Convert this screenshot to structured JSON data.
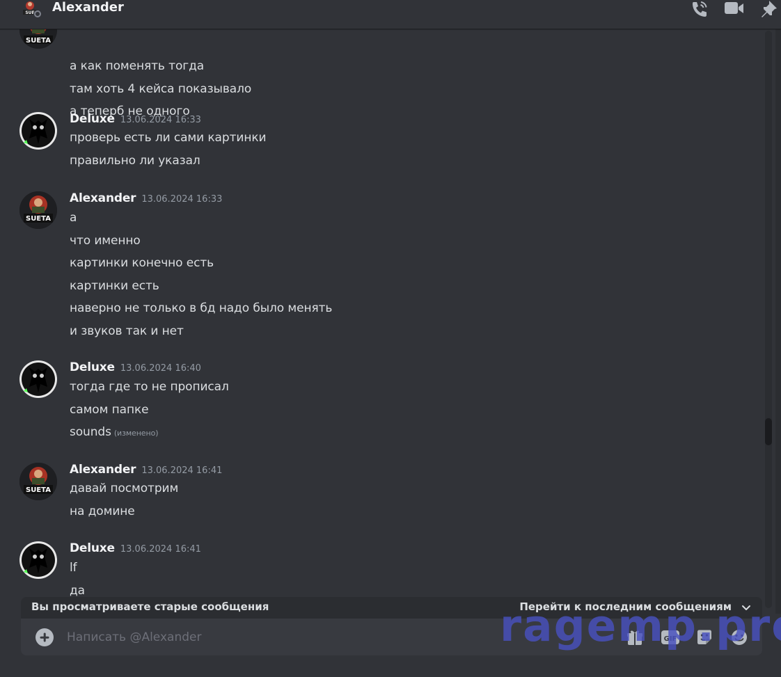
{
  "header": {
    "title": "Alexander",
    "avatar_label": "SUE",
    "icons": [
      "phone-call-icon",
      "video-camera-icon",
      "pin-icon"
    ]
  },
  "colors": {
    "background": "#313338",
    "header_title": "#f2f3f5",
    "timestamp": "#949ba4",
    "composer_bg": "#383a40",
    "watermark": "#4850be"
  },
  "continuation": {
    "lines": [
      "а как поменять тогда",
      "там хоть 4 кейса показывало",
      "а теперб не одного"
    ]
  },
  "messages": [
    {
      "author": "Deluxe",
      "time": "13.06.2024 16:33",
      "lines": [
        "проверь есть ли сами картинки",
        "правильно ли указал"
      ]
    },
    {
      "author": "Alexander",
      "time": "13.06.2024 16:33",
      "avatar_label": "SUETA",
      "lines": [
        "а",
        "что именно",
        "картинки конечно есть",
        "картинки есть",
        "наверно не только в бд надо было менять",
        "и звуков так и нет"
      ]
    },
    {
      "author": "Deluxe",
      "time": "13.06.2024 16:40",
      "lines": [
        "тогда где то не прописал",
        "самом папке",
        "sounds"
      ],
      "edited": "(изменено)"
    },
    {
      "author": "Alexander",
      "time": "13.06.2024 16:41",
      "avatar_label": "SUETA",
      "lines": [
        "давай посмотрим",
        "на домине"
      ]
    },
    {
      "author": "Deluxe",
      "time": "13.06.2024 16:41",
      "lines": [
        "lf",
        "да"
      ]
    }
  ],
  "jump_bar": {
    "text": "Вы просматриваете старые сообщения",
    "link": "Перейти к последним сообщениям"
  },
  "composer": {
    "placeholder": "Написать @Alexander",
    "gif_label": "GIF",
    "icons": [
      "add-attachment-icon",
      "gift-icon",
      "gif-icon",
      "sticker-icon",
      "emoji-icon"
    ]
  },
  "watermark": "ragemp.pro"
}
